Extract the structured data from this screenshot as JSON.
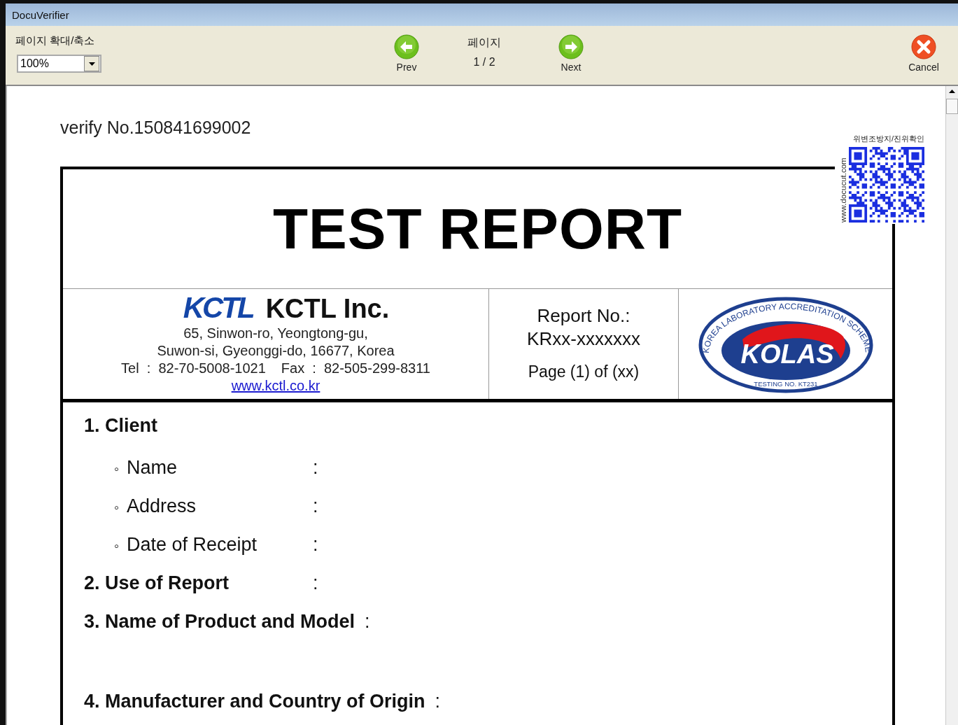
{
  "window": {
    "title": "DocuVerifier"
  },
  "toolbar": {
    "zoom_label": "페이지 확대/축소",
    "zoom_value": "100%",
    "prev": "Prev",
    "page_label": "페이지",
    "page_counter": "1 / 2",
    "next": "Next",
    "cancel": "Cancel"
  },
  "document": {
    "verify_number": "verify No.150841699002",
    "qr": {
      "caption": "위변조방지/진위확인",
      "url": "www.docucut.com"
    },
    "title": "TEST REPORT",
    "company": {
      "logo": "KCTL",
      "name": "KCTL Inc.",
      "address_lines": [
        "65, Sinwon-ro, Yeongtong-gu,",
        "Suwon-si, Gyeonggi-do, 16677, Korea"
      ],
      "tel": "Tel  :  82-70-5008-1021",
      "fax": "Fax  :  82-505-299-8311",
      "website": "www.kctl.co.kr"
    },
    "report": {
      "number_label": "Report No.:",
      "number": "KRxx-xxxxxxx",
      "page": "Page (1) of (xx)"
    },
    "emblem": {
      "ring_text": "KOREA LABORATORY ACCREDITATION SCHEME",
      "mark": "KOLAS",
      "testing_no": "TESTING NO. KT231"
    },
    "fields": [
      {
        "kind": "section",
        "label": "1. Client"
      },
      {
        "kind": "item",
        "bullet": "◦",
        "label": "Name",
        "separator": ":"
      },
      {
        "kind": "item",
        "bullet": "◦",
        "label": "Address",
        "separator": ":"
      },
      {
        "kind": "item",
        "bullet": "◦",
        "label": "Date of Receipt",
        "separator": ":"
      },
      {
        "kind": "field",
        "label": "2. Use of Report",
        "separator": ":"
      },
      {
        "kind": "field-tall",
        "label": "3. Name of Product and Model",
        "separator": ":"
      },
      {
        "kind": "field",
        "label": "4. Manufacturer and Country of Origin",
        "separator": ":"
      }
    ]
  }
}
